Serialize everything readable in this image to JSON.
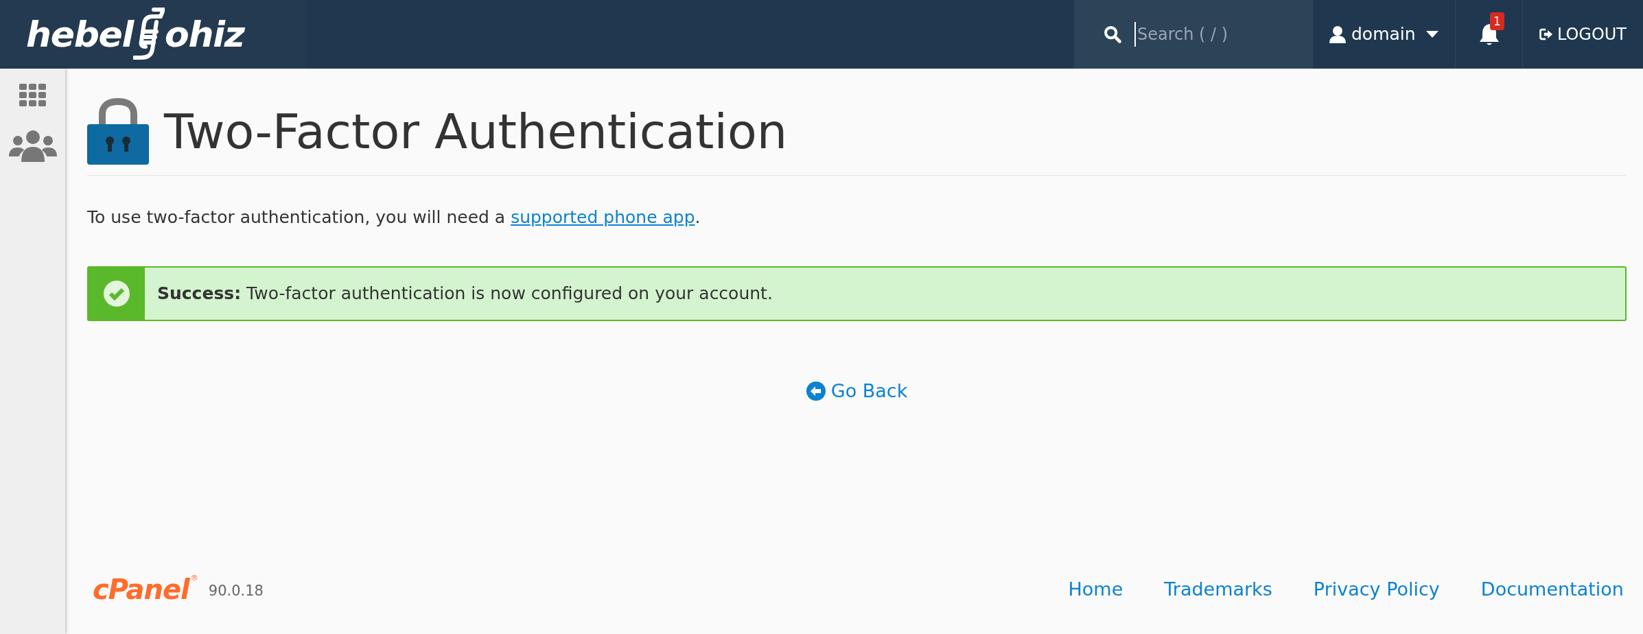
{
  "header": {
    "logo": {
      "left": "hebel",
      "right": "ohiz"
    },
    "search": {
      "placeholder": "Search ( / )"
    },
    "user": {
      "label": "domain"
    },
    "notifications": {
      "count": "1"
    },
    "logout": {
      "label": "LOGOUT"
    }
  },
  "sidebar": {
    "items": [
      {
        "kind": "grid",
        "selected": false
      },
      {
        "kind": "users",
        "selected": false
      }
    ]
  },
  "page": {
    "title": "Two-Factor Authentication",
    "intro": {
      "text": "To use two-factor authentication, you will need a ",
      "link": "supported phone app",
      "after": "."
    },
    "alert": {
      "kind": "success",
      "text": "**Success:** Two-factor authentication is now configured on your account."
    },
    "back_link": "Go Back"
  },
  "footer": {
    "brand": "cPanel",
    "registered": "®",
    "version": "90.0.18",
    "links": [
      "Home",
      "Trademarks",
      "Privacy Policy",
      "Documentation"
    ]
  }
}
